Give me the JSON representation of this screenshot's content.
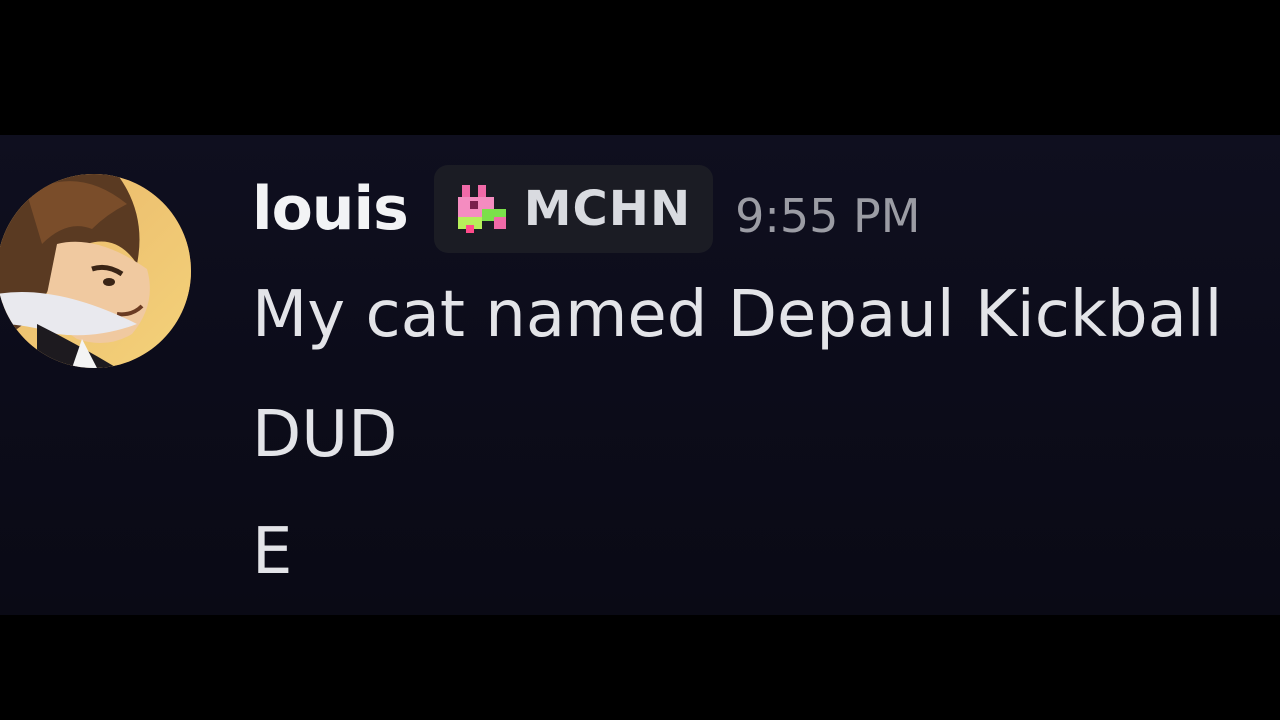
{
  "message": {
    "author": "louis",
    "tag": {
      "label": "MCHN",
      "icon": "pixel-dog-tag-icon"
    },
    "timestamp": "9:55 PM",
    "lines": [
      "My cat named Depaul Kickball",
      "DUD",
      "E"
    ]
  },
  "colors": {
    "outer_background": "#000000",
    "message_background": "#0e0e1c",
    "username": "#f2f3f5",
    "tag_background": "#1b1c24",
    "timestamp": "#9b9ca4",
    "message_text": "#e3e4e8"
  }
}
